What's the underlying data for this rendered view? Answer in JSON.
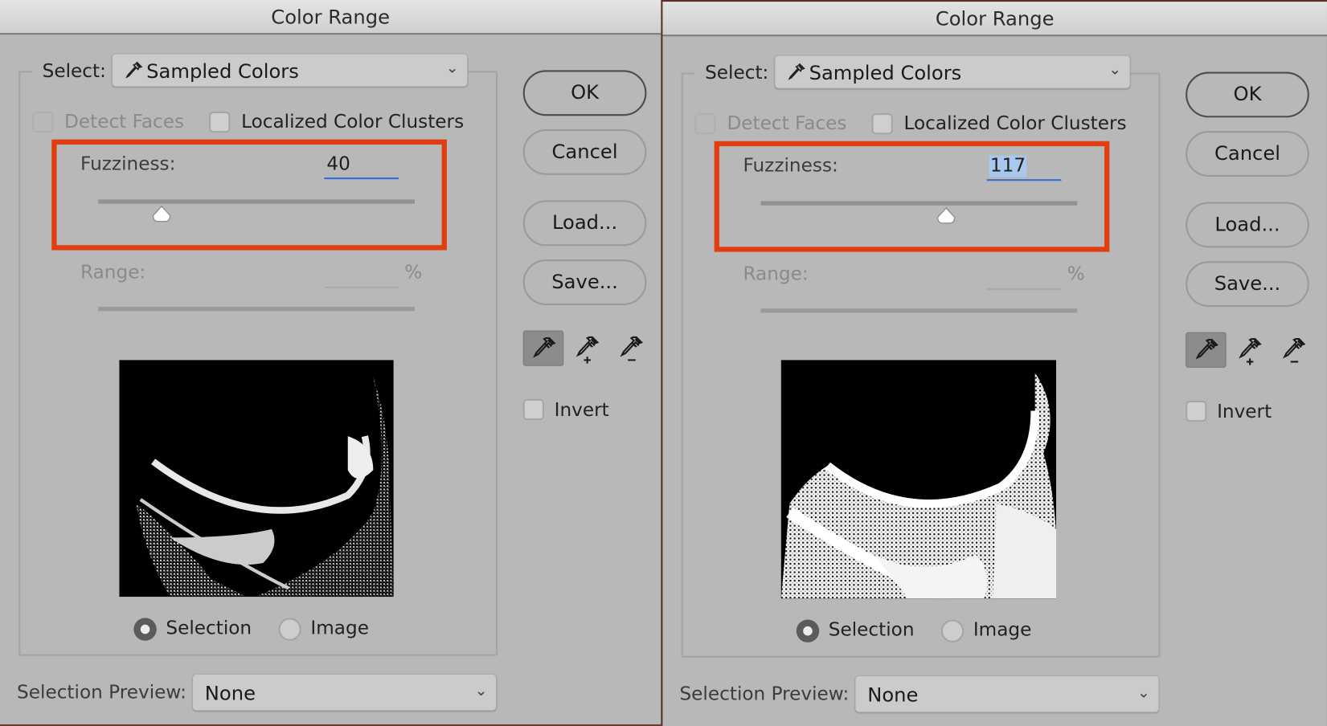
{
  "dialogs": [
    {
      "title": "Color Range",
      "select_label": "Select:",
      "select_value": "Sampled Colors",
      "detect_faces": {
        "label": "Detect Faces",
        "checked": false,
        "enabled": false
      },
      "localized_clusters": {
        "label": "Localized Color Clusters",
        "checked": false
      },
      "fuzziness": {
        "label": "Fuzziness:",
        "value": "40",
        "slider_fraction": 0.2,
        "text_selected": false
      },
      "range": {
        "label": "Range:",
        "value": "",
        "unit": "%",
        "enabled": false
      },
      "buttons": {
        "ok": "OK",
        "cancel": "Cancel",
        "load": "Load...",
        "save": "Save..."
      },
      "invert": {
        "label": "Invert",
        "checked": false
      },
      "view": {
        "selection": "Selection",
        "image": "Image",
        "selected": "selection"
      },
      "selection_preview": {
        "label": "Selection Preview:",
        "value": "None"
      }
    },
    {
      "title": "Color Range",
      "select_label": "Select:",
      "select_value": "Sampled Colors",
      "detect_faces": {
        "label": "Detect Faces",
        "checked": false,
        "enabled": false
      },
      "localized_clusters": {
        "label": "Localized Color Clusters",
        "checked": false
      },
      "fuzziness": {
        "label": "Fuzziness:",
        "value": "117",
        "slider_fraction": 0.585,
        "text_selected": true
      },
      "range": {
        "label": "Range:",
        "value": "",
        "unit": "%",
        "enabled": false
      },
      "buttons": {
        "ok": "OK",
        "cancel": "Cancel",
        "load": "Load...",
        "save": "Save..."
      },
      "invert": {
        "label": "Invert",
        "checked": false
      },
      "view": {
        "selection": "Selection",
        "image": "Image",
        "selected": "selection"
      },
      "selection_preview": {
        "label": "Selection Preview:",
        "value": "None"
      }
    }
  ],
  "icons": {
    "select_dropdown": "eyedropper-icon",
    "tools": [
      "eyedropper-icon",
      "eyedropper-add-icon",
      "eyedropper-subtract-icon"
    ],
    "dropdown_chevron": "chevron-down-icon"
  },
  "colors": {
    "dialog_bg": "#b8b8b8",
    "highlight_annotation": "#e03e10",
    "focus_underline": "#2f6fd6",
    "text_selection": "#a9c8ef"
  }
}
